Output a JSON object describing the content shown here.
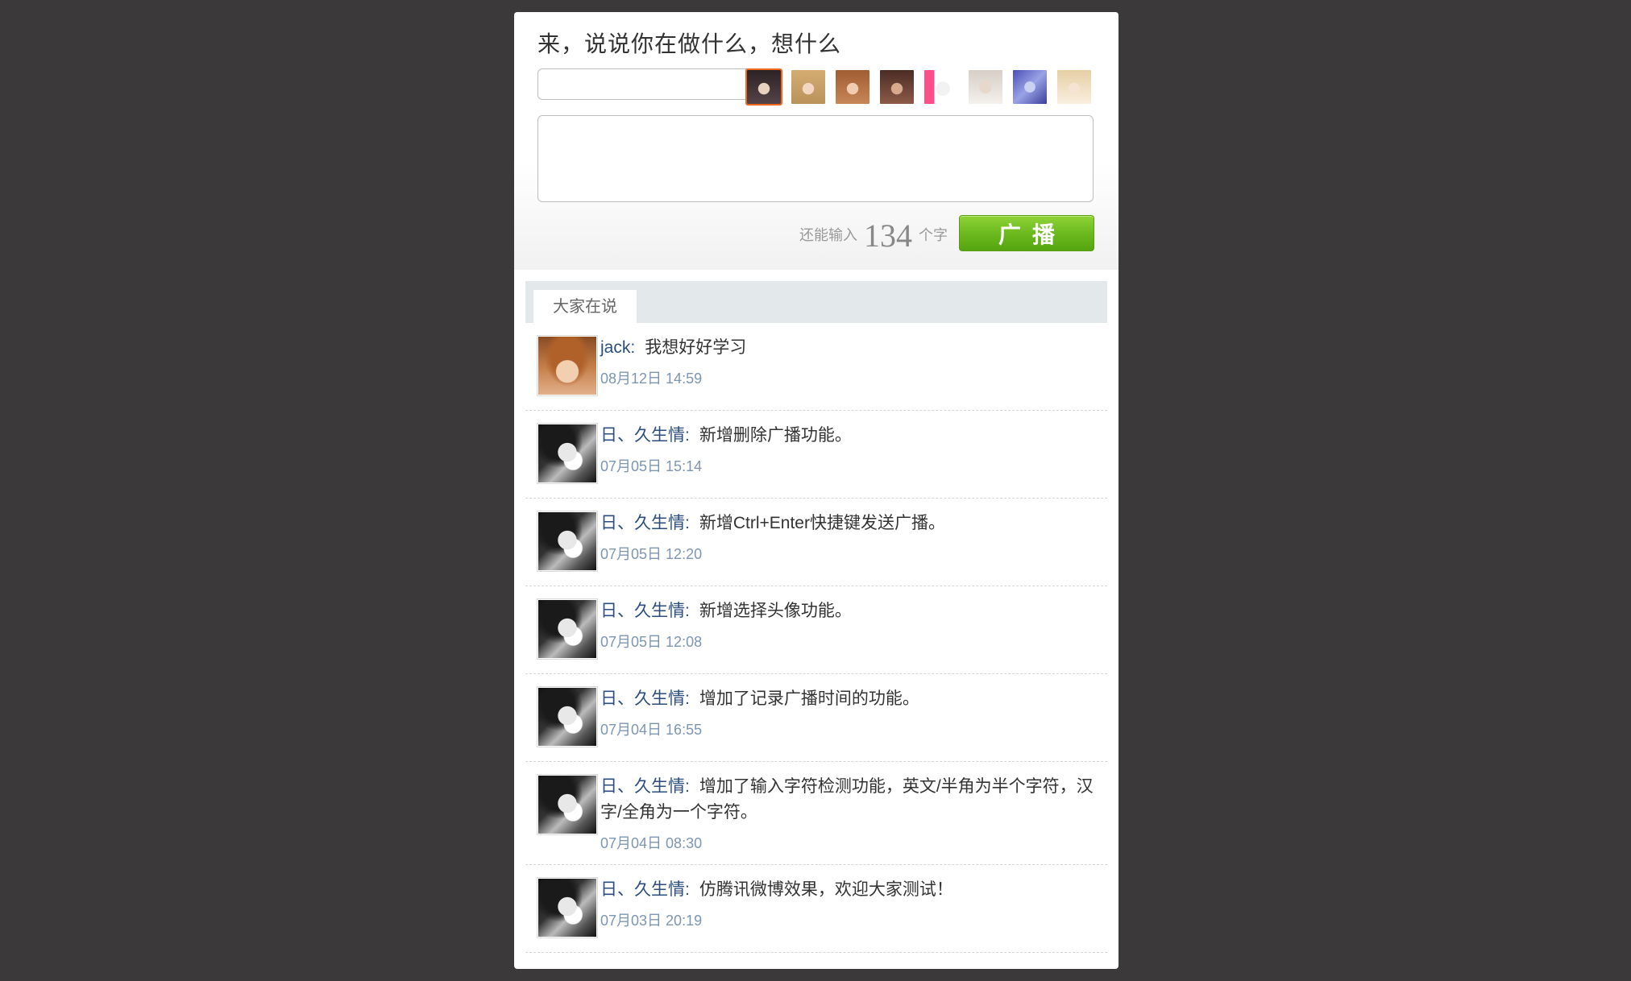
{
  "compose": {
    "title": "来，说说你在做什么，想什么",
    "name_placeholder": "",
    "name_value": "",
    "message_value": "",
    "counter_prefix": "还能输入",
    "counter_value": "134",
    "counter_suffix": "个字",
    "broadcast_label": "广播",
    "avatars": [
      {
        "icon": "avatar-option-1",
        "style": "face-dark",
        "selected": true
      },
      {
        "icon": "avatar-option-2",
        "style": "face-blonde",
        "selected": false
      },
      {
        "icon": "avatar-option-3",
        "style": "face-auburn",
        "selected": false
      },
      {
        "icon": "avatar-option-4",
        "style": "face-brown",
        "selected": false
      },
      {
        "icon": "avatar-option-5",
        "style": "face-pink",
        "selected": false
      },
      {
        "icon": "avatar-option-6",
        "style": "face-man",
        "selected": false
      },
      {
        "icon": "avatar-option-7",
        "style": "face-blue",
        "selected": false
      },
      {
        "icon": "avatar-option-8",
        "style": "face-light",
        "selected": false
      }
    ]
  },
  "feed": {
    "tab_label": "大家在说",
    "separator": ":",
    "items": [
      {
        "author": "jack",
        "message": "我想好好学习",
        "time": "08月12日 14:59",
        "avatar": "face-warm"
      },
      {
        "author": "日、久生情",
        "message": "新增删除广播功能。",
        "time": "07月05日 15:14",
        "avatar": "face-bw"
      },
      {
        "author": "日、久生情",
        "message": "新增Ctrl+Enter快捷键发送广播。",
        "time": "07月05日 12:20",
        "avatar": "face-bw"
      },
      {
        "author": "日、久生情",
        "message": "新增选择头像功能。",
        "time": "07月05日 12:08",
        "avatar": "face-bw"
      },
      {
        "author": "日、久生情",
        "message": "增加了记录广播时间的功能。",
        "time": "07月04日 16:55",
        "avatar": "face-bw"
      },
      {
        "author": "日、久生情",
        "message": "增加了输入字符检测功能，英文/半角为半个字符，汉字/全角为一个字符。",
        "time": "07月04日 08:30",
        "avatar": "face-bw"
      },
      {
        "author": "日、久生情",
        "message": "仿腾讯微博效果，欢迎大家测试！",
        "time": "07月03日 20:19",
        "avatar": "face-bw"
      }
    ]
  }
}
